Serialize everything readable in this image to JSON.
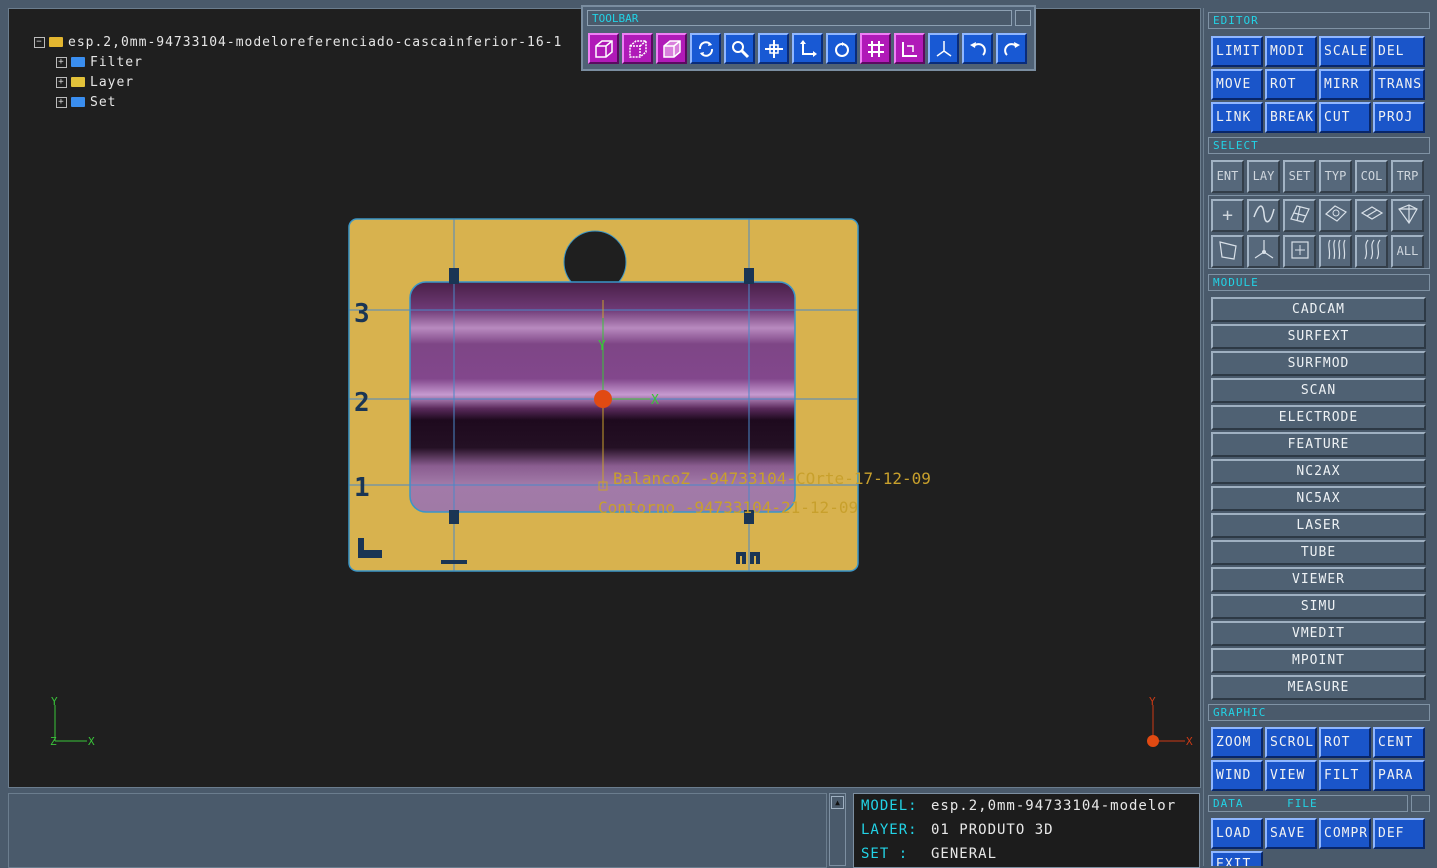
{
  "tree": {
    "root_label": "esp.2,0mm-94733104-modeloreferenciado-cascainferior-16-1",
    "items": [
      {
        "label": "Filter",
        "icon": "folder-blue-icon"
      },
      {
        "label": "Layer",
        "icon": "folder-yellow-icon"
      },
      {
        "label": "Set",
        "icon": "folder-blue-icon"
      }
    ]
  },
  "toolbar": {
    "title": "TOOLBAR",
    "buttons": [
      {
        "icon": "cube-wireframe-icon",
        "color": "#b01ab8"
      },
      {
        "icon": "cube-hidden-line-icon",
        "color": "#b01ab8"
      },
      {
        "icon": "cube-shaded-icon",
        "color": "#b01ab8"
      },
      {
        "icon": "rotate-view-icon",
        "color": "#1859d4"
      },
      {
        "icon": "zoom-icon",
        "color": "#1859d4"
      },
      {
        "icon": "pan-icon",
        "color": "#1859d4"
      },
      {
        "icon": "axis-system-icon",
        "color": "#1859d4"
      },
      {
        "icon": "redraw-icon",
        "color": "#1859d4"
      },
      {
        "icon": "grid-icon",
        "color": "#b01ab8"
      },
      {
        "icon": "frame-icon",
        "color": "#b01ab8"
      },
      {
        "icon": "xyz-axes-icon",
        "color": "#1859d4"
      },
      {
        "icon": "undo-icon",
        "color": "#1859d4"
      },
      {
        "icon": "redo-icon",
        "color": "#1859d4"
      }
    ]
  },
  "viewport": {
    "labels": {
      "balanco": "BalancoZ -94733104-COrte-17-12-09",
      "contorno": "Contorno -94733104-21-12-09",
      "ruler_3": "3",
      "ruler_2": "2",
      "ruler_1": "1",
      "axis_x": "X",
      "axis_y": "Y",
      "axis_z": "Z"
    },
    "colors": {
      "part": "#d8b24e",
      "pocket": "#7e3d84",
      "annotation": "#c8a02c",
      "axis_green": "#3ac43a"
    }
  },
  "editor": {
    "title": "EDITOR",
    "buttons": [
      "LIMIT",
      "MODI",
      "SCALE",
      "DEL",
      "MOVE",
      "ROT",
      "MIRR",
      "TRANS",
      "LINK",
      "BREAK",
      "CUT",
      "PROJ"
    ]
  },
  "select": {
    "title": "SELECT",
    "buttons": [
      "ENT",
      "LAY",
      "SET",
      "TYP",
      "COL",
      "TRP"
    ],
    "icon_buttons_row1": [
      "point-icon",
      "curve-icon",
      "surface-icon",
      "solid-icon",
      "plane-icon",
      "body-icon"
    ],
    "icon_buttons_row2": [
      "face-icon",
      "axis-icon",
      "box-select-icon",
      "hatch-icon",
      "multi-curve-icon"
    ],
    "all_label": "ALL"
  },
  "module": {
    "title": "MODULE",
    "buttons": [
      "CADCAM",
      "SURFEXT",
      "SURFMOD",
      "SCAN",
      "ELECTRODE",
      "FEATURE",
      "NC2AX",
      "NC5AX",
      "LASER",
      "TUBE",
      "VIEWER",
      "SIMU",
      "VMEDIT",
      "MPOINT",
      "MEASURE"
    ]
  },
  "graphic": {
    "title": "GRAPHIC",
    "buttons": [
      "ZOOM",
      "SCROL",
      "ROT",
      "CENT",
      "WIND",
      "VIEW",
      "FILT",
      "PARA"
    ]
  },
  "data_file": {
    "title_data": "DATA",
    "title_file": "FILE",
    "buttons": [
      "LOAD",
      "SAVE",
      "COMPR",
      "DEF",
      "EXIT"
    ]
  },
  "status": {
    "model_label": "MODEL:",
    "model_value": "esp.2,0mm-94733104-modelor",
    "layer_label": "LAYER:",
    "layer_value": "01 PRODUTO 3D",
    "set_label": "SET  :",
    "set_value": "GENERAL"
  }
}
